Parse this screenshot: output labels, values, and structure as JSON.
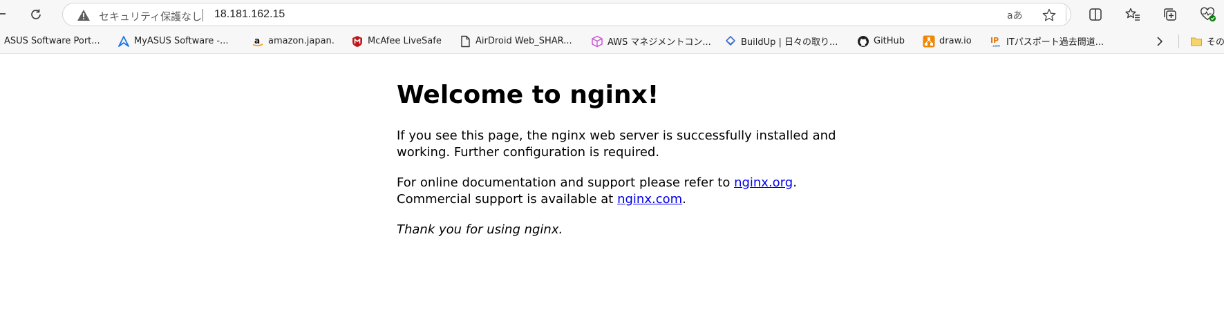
{
  "address_bar": {
    "security_text": "セキュリティ保護なし",
    "url": "18.181.162.15",
    "read_aloud_label": "aあ"
  },
  "favorites": [
    {
      "label": "ASUS Software Port...",
      "icon": "none"
    },
    {
      "label": "MyASUS Software -...",
      "icon": "myasus-icon"
    },
    {
      "label": "amazon.japan.",
      "icon": "amazon-icon"
    },
    {
      "label": "McAfee LiveSafe",
      "icon": "mcafee-icon"
    },
    {
      "label": "AirDroid Web_SHAR...",
      "icon": "page-icon"
    },
    {
      "label": "AWS マネジメントコン...",
      "icon": "aws-cube-icon"
    },
    {
      "label": "BuildUp | 日々の取り...",
      "icon": "buildup-icon"
    },
    {
      "label": "GitHub",
      "icon": "github-icon"
    },
    {
      "label": "draw.io",
      "icon": "drawio-icon"
    },
    {
      "label": "ITパスポート過去問道...",
      "icon": "ip-icon"
    },
    {
      "label": "その",
      "icon": "folder-icon"
    }
  ],
  "page": {
    "heading": "Welcome to nginx!",
    "para1": "If you see this page, the nginx web server is successfully installed and working. Further configuration is required.",
    "para2_prefix": "For online documentation and support please refer to ",
    "link1": "nginx.org",
    "para2_mid": ".",
    "para2_line2_prefix": "Commercial support is available at ",
    "link2": "nginx.com",
    "para2_suffix": ".",
    "thanks": "Thank you for using nginx."
  },
  "colors": {
    "link": "#0000ee",
    "chrome_bg": "#f7f7f7",
    "amazon_orange": "#ff9900",
    "mcafee_red": "#c01818",
    "drawio_orange": "#f08705",
    "myasus_blue": "#1a73e8"
  }
}
